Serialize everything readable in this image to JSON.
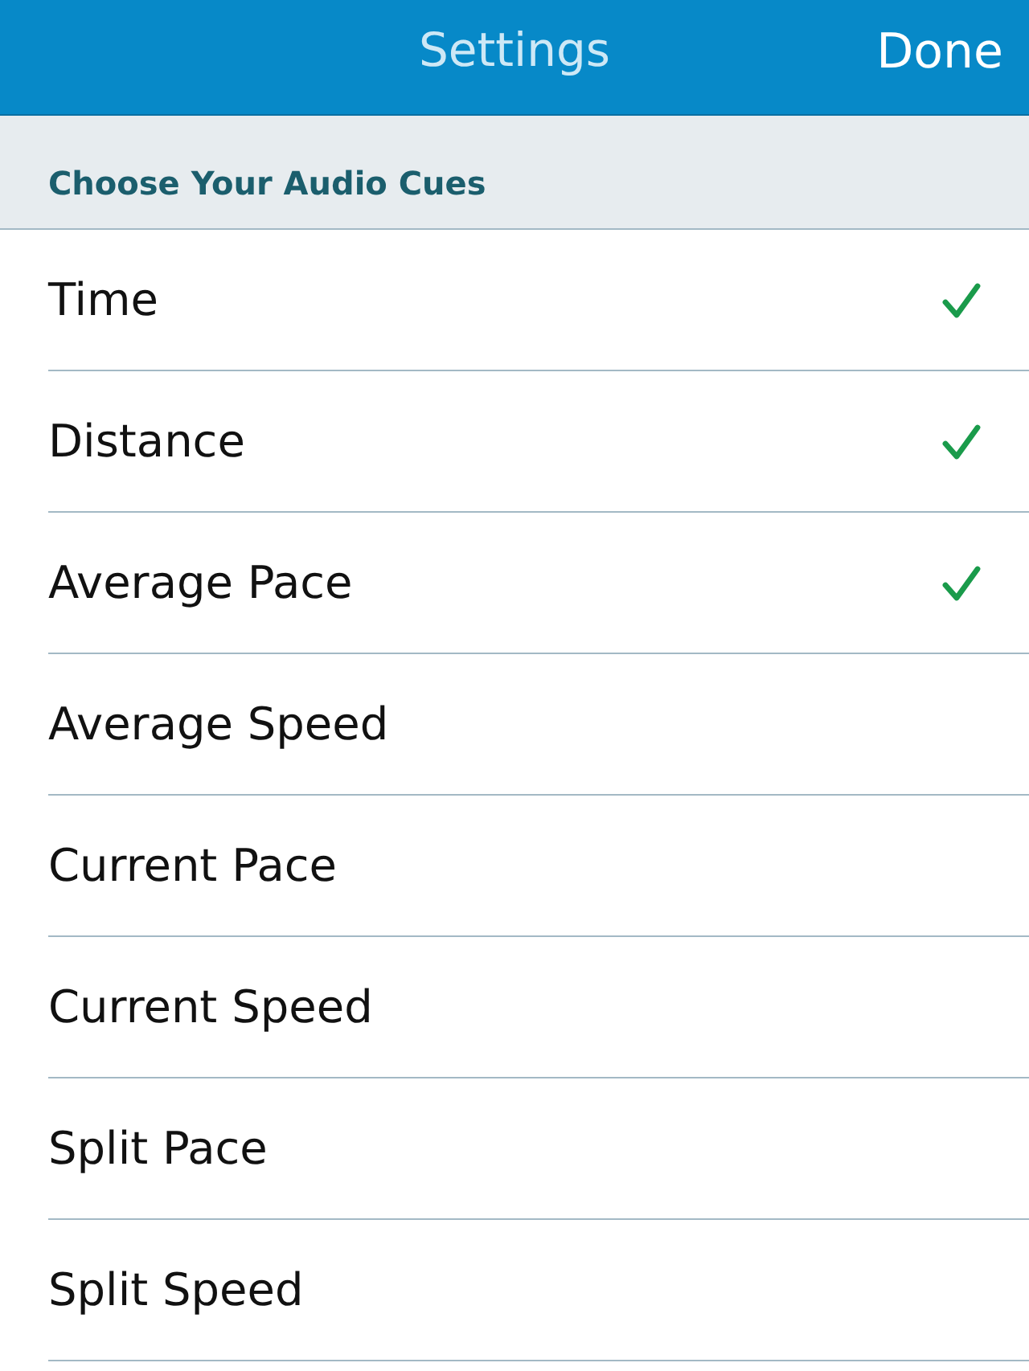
{
  "nav_bar": {
    "title": "Settings",
    "done_button": "Done"
  },
  "section": {
    "title": "Choose Your Audio Cues"
  },
  "cues": [
    {
      "label": "Time",
      "checked": true
    },
    {
      "label": "Distance",
      "checked": true
    },
    {
      "label": "Average Pace",
      "checked": true
    },
    {
      "label": "Average Speed",
      "checked": false
    },
    {
      "label": "Current Pace",
      "checked": false
    },
    {
      "label": "Current Speed",
      "checked": false
    },
    {
      "label": "Split Pace",
      "checked": false
    },
    {
      "label": "Split Speed",
      "checked": false
    }
  ]
}
